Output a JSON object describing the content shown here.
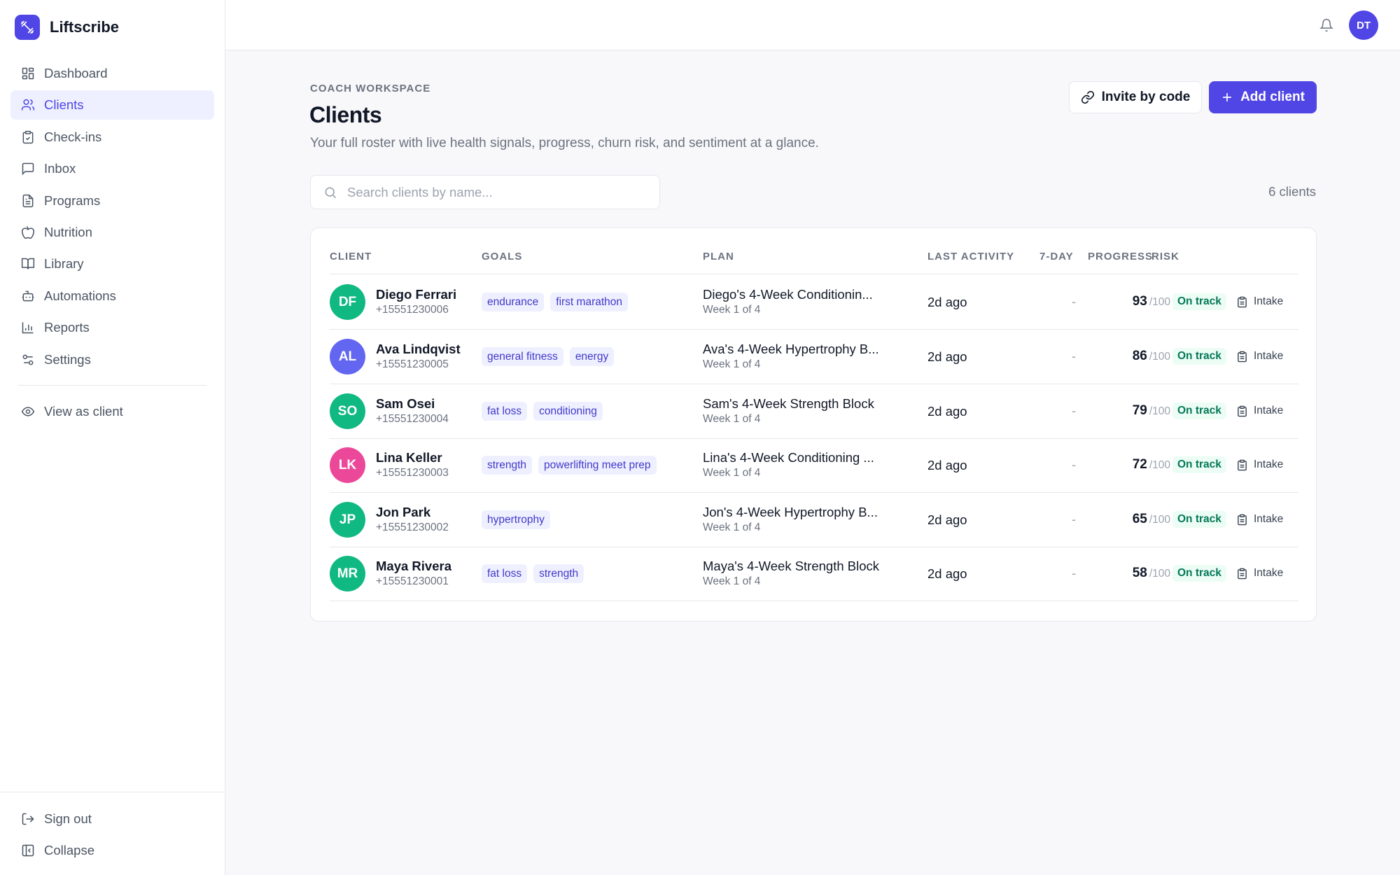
{
  "app": {
    "name": "Liftscribe",
    "brand_color": "#5046e5"
  },
  "sidebar": {
    "items": [
      {
        "label": "Dashboard",
        "icon": "dashboard-icon"
      },
      {
        "label": "Clients",
        "icon": "users-icon",
        "active": true
      },
      {
        "label": "Check-ins",
        "icon": "clipboard-check-icon"
      },
      {
        "label": "Inbox",
        "icon": "message-icon"
      },
      {
        "label": "Programs",
        "icon": "file-text-icon"
      },
      {
        "label": "Nutrition",
        "icon": "apple-icon"
      },
      {
        "label": "Library",
        "icon": "book-open-icon"
      },
      {
        "label": "Automations",
        "icon": "bot-icon"
      },
      {
        "label": "Reports",
        "icon": "bar-chart-icon"
      },
      {
        "label": "Settings",
        "icon": "sliders-icon"
      }
    ],
    "view_as_client": "View as client",
    "sign_out": "Sign out",
    "collapse": "Collapse"
  },
  "topbar": {
    "user_initials": "DT"
  },
  "page": {
    "eyebrow": "COACH WORKSPACE",
    "title": "Clients",
    "subtitle": "Your full roster with live health signals, progress, churn risk, and sentiment at a glance.",
    "invite_label": "Invite by code",
    "add_label": "Add client",
    "search_placeholder": "Search clients by name...",
    "count_label": "6 clients"
  },
  "table": {
    "headers": {
      "client": "CLIENT",
      "goals": "GOALS",
      "plan": "PLAN",
      "last_activity": "LAST ACTIVITY",
      "seven_day": "7-DAY",
      "progress": "PROGRESS",
      "risk": "RISK"
    },
    "rows": [
      {
        "initials": "DF",
        "avatar_color": "#10b981",
        "name": "Diego Ferrari",
        "phone": "+15551230006",
        "goals": [
          "endurance",
          "first marathon"
        ],
        "plan": "Diego's 4-Week Conditionin...",
        "week": "Week 1 of 4",
        "last_activity": "2d ago",
        "seven_day": "-",
        "progress": "93",
        "progress_max": "/100",
        "risk": "On track",
        "action": "Intake"
      },
      {
        "initials": "AL",
        "avatar_color": "#6366f1",
        "name": "Ava Lindqvist",
        "phone": "+15551230005",
        "goals": [
          "general fitness",
          "energy"
        ],
        "plan": "Ava's 4-Week Hypertrophy B...",
        "week": "Week 1 of 4",
        "last_activity": "2d ago",
        "seven_day": "-",
        "progress": "86",
        "progress_max": "/100",
        "risk": "On track",
        "action": "Intake"
      },
      {
        "initials": "SO",
        "avatar_color": "#10b981",
        "name": "Sam Osei",
        "phone": "+15551230004",
        "goals": [
          "fat loss",
          "conditioning"
        ],
        "plan": "Sam's 4-Week Strength Block",
        "week": "Week 1 of 4",
        "last_activity": "2d ago",
        "seven_day": "-",
        "progress": "79",
        "progress_max": "/100",
        "risk": "On track",
        "action": "Intake"
      },
      {
        "initials": "LK",
        "avatar_color": "#ec4899",
        "name": "Lina Keller",
        "phone": "+15551230003",
        "goals": [
          "strength",
          "powerlifting meet prep"
        ],
        "plan": "Lina's 4-Week Conditioning ...",
        "week": "Week 1 of 4",
        "last_activity": "2d ago",
        "seven_day": "-",
        "progress": "72",
        "progress_max": "/100",
        "risk": "On track",
        "action": "Intake"
      },
      {
        "initials": "JP",
        "avatar_color": "#10b981",
        "name": "Jon Park",
        "phone": "+15551230002",
        "goals": [
          "hypertrophy"
        ],
        "plan": "Jon's 4-Week Hypertrophy B...",
        "week": "Week 1 of 4",
        "last_activity": "2d ago",
        "seven_day": "-",
        "progress": "65",
        "progress_max": "/100",
        "risk": "On track",
        "action": "Intake"
      },
      {
        "initials": "MR",
        "avatar_color": "#10b981",
        "name": "Maya Rivera",
        "phone": "+15551230001",
        "goals": [
          "fat loss",
          "strength"
        ],
        "plan": "Maya's 4-Week Strength Block",
        "week": "Week 1 of 4",
        "last_activity": "2d ago",
        "seven_day": "-",
        "progress": "58",
        "progress_max": "/100",
        "risk": "On track",
        "action": "Intake"
      }
    ]
  }
}
